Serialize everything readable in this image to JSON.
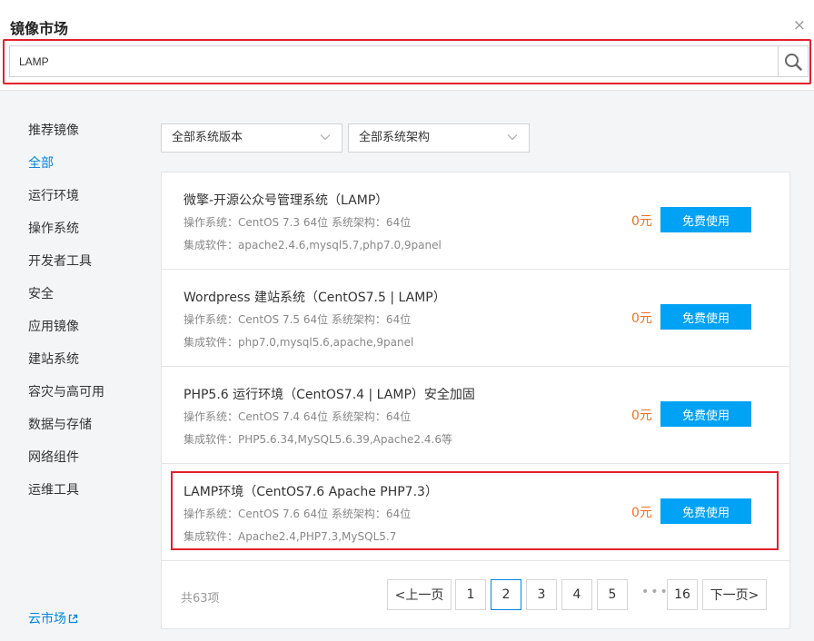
{
  "modal": {
    "title": "镜像市场",
    "close_glyph": "×"
  },
  "search": {
    "value": "LAMP",
    "placeholder": ""
  },
  "sidebar": {
    "items": [
      {
        "label": "推荐镜像"
      },
      {
        "label": "全部",
        "active": true
      },
      {
        "label": "运行环境"
      },
      {
        "label": "操作系统"
      },
      {
        "label": "开发者工具"
      },
      {
        "label": "安全"
      },
      {
        "label": "应用镜像"
      },
      {
        "label": "建站系统"
      },
      {
        "label": "容灾与高可用"
      },
      {
        "label": "数据与存储"
      },
      {
        "label": "网络组件"
      },
      {
        "label": "运维工具"
      }
    ],
    "footer_link": "云市场"
  },
  "filters": {
    "version": "全部系统版本",
    "arch": "全部系统架构"
  },
  "images": [
    {
      "name": "微擎-开源公众号管理系统（LAMP）",
      "os": "操作系统：CentOS 7.3 64位    系统架构：64位",
      "software": "集成软件：apache2.4.6,mysql5.7,php7.0,9panel",
      "price": "0元",
      "action": "免费使用"
    },
    {
      "name": "Wordpress 建站系统（CentOS7.5 | LAMP）",
      "os": "操作系统：CentOS 7.5 64位    系统架构：64位",
      "software": "集成软件：php7.0,mysql5.6,apache,9panel",
      "price": "0元",
      "action": "免费使用"
    },
    {
      "name": "PHP5.6 运行环境（CentOS7.4 | LAMP）安全加固",
      "os": "操作系统：CentOS 7.4 64位    系统架构：64位",
      "software": "集成软件：PHP5.6.34,MySQL5.6.39,Apache2.4.6等",
      "price": "0元",
      "action": "免费使用"
    },
    {
      "name": "LAMP环境（CentOS7.6 Apache PHP7.3）",
      "os": "操作系统：CentOS 7.6 64位    系统架构：64位",
      "software": "集成软件：Apache2.4,PHP7.3,MySQL5.7",
      "price": "0元",
      "action": "免费使用"
    }
  ],
  "pagination": {
    "total": "共63项",
    "prev": "<上一页",
    "pages": [
      "1",
      "2",
      "3",
      "4",
      "5"
    ],
    "current": "2",
    "ellipsis": "•••",
    "last": "16",
    "next": "下一页>"
  },
  "colors": {
    "accent": "#0087e0",
    "button": "#00a2f5",
    "price": "#f27020",
    "highlight": "#e4202e"
  }
}
